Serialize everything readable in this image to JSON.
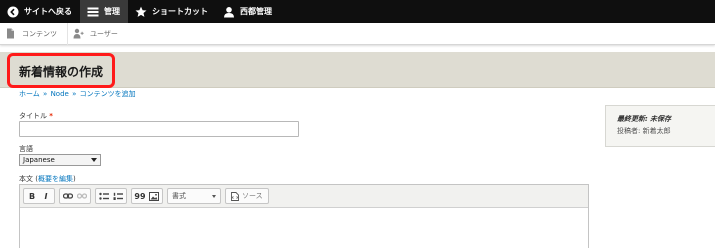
{
  "toolbar": {
    "back_label": "サイトへ戻る",
    "manage_label": "管理",
    "shortcuts_label": "ショートカット",
    "user_label": "西都管理"
  },
  "tray": {
    "content_label": "コンテンツ",
    "people_label": "ユーザー"
  },
  "page": {
    "title": "新着情報の作成"
  },
  "breadcrumb": {
    "home": "ホーム",
    "sep1": "»",
    "node": "Node",
    "sep2": "»",
    "add": "コンテンツを追加"
  },
  "form": {
    "title_label": "タイトル",
    "required_mark": "*",
    "title_value": "",
    "language_label": "言語",
    "language_value": "Japanese",
    "body_label_prefix": "本文 (",
    "body_summary_link": "概要を編集",
    "body_label_suffix": ")"
  },
  "editor": {
    "bold": "B",
    "italic": "I",
    "quote": "99",
    "format_select": "書式",
    "source_label": "ソース"
  },
  "meta": {
    "last_saved_key": "最終更新",
    "last_saved_sep": ":",
    "last_saved_value": "未保存",
    "author_key": "投稿者",
    "author_sep": ":",
    "author_value": "新着太郎"
  },
  "colors": {
    "toolbar_bg": "#0f0f0f",
    "title_band": "#dedcd2",
    "highlight": "#ff1a1a",
    "link": "#0074bd",
    "required": "#e62600"
  }
}
